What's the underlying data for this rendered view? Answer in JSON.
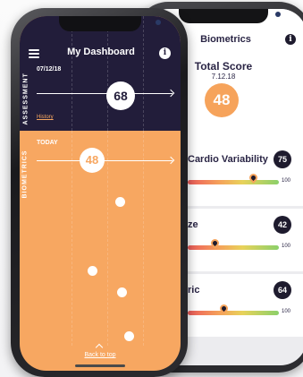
{
  "back_screen": {
    "title": "Biometrics",
    "info_icon": "i",
    "total_score": {
      "label": "Total Score",
      "date": "7.12.18",
      "value": "48"
    },
    "metrics": [
      {
        "name": "Cardio Variability",
        "score": "75",
        "max_label": "100",
        "level": 0.72
      },
      {
        "name": "ze",
        "score": "42",
        "max_label": "100",
        "level": 0.3
      },
      {
        "name": "ric",
        "score": "64",
        "max_label": "100",
        "level": 0.4
      }
    ]
  },
  "front_screen": {
    "title": "My Dashboard",
    "menu_icon": "hamburger-menu-icon",
    "info_icon": "i",
    "assessment": {
      "section_label": "ASSESSMENT",
      "date": "07/12/18",
      "score": "68",
      "history_link": "History"
    },
    "biometrics": {
      "section_label": "BIOMETRICS",
      "today_label": "TODAY",
      "score": "48"
    },
    "back_to_top": "Back to top"
  },
  "colors": {
    "navy": "#221d3a",
    "orange": "#f7a761",
    "white": "#ffffff",
    "gradient": [
      "#ec5a5a",
      "#f5a25a",
      "#e8d25a",
      "#8bd06a"
    ]
  }
}
